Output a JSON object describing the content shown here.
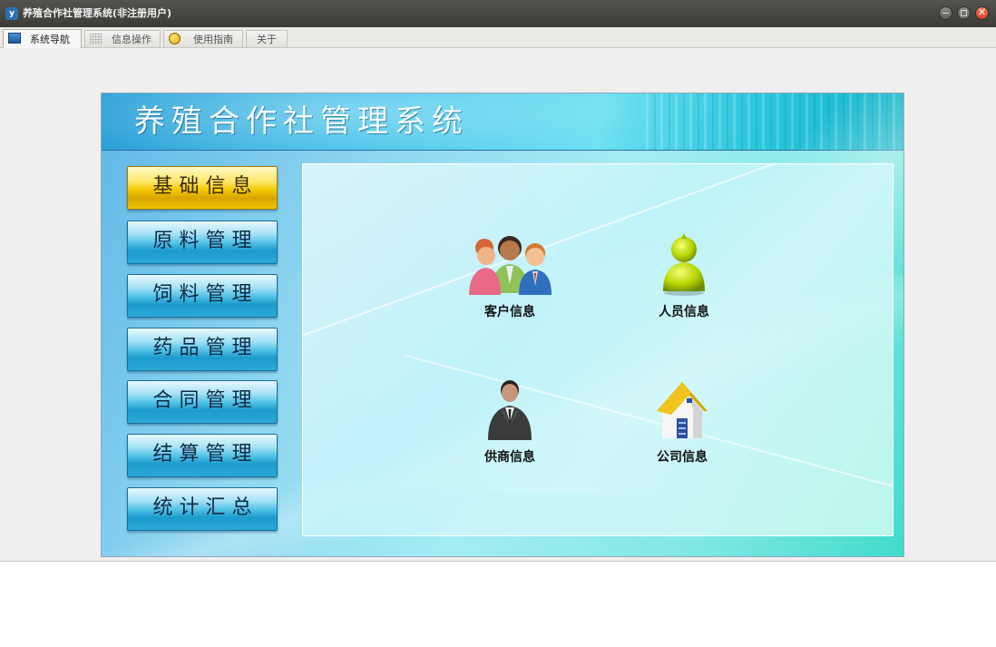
{
  "window": {
    "title": "养殖合作社管理系统(非注册用户)",
    "app_icon": "y"
  },
  "tabs": [
    {
      "label": "系统导航",
      "icon": "monitor-icon"
    },
    {
      "label": "信息操作",
      "icon": "grid-icon"
    },
    {
      "label": "使用指南",
      "icon": "guide-icon"
    },
    {
      "label": "关于",
      "icon": ""
    }
  ],
  "panel": {
    "title": "养殖合作社管理系统"
  },
  "sidebar": {
    "items": [
      {
        "label": "基础信息",
        "active": true
      },
      {
        "label": "原料管理",
        "active": false
      },
      {
        "label": "饲料管理",
        "active": false
      },
      {
        "label": "药品管理",
        "active": false
      },
      {
        "label": "合同管理",
        "active": false
      },
      {
        "label": "结算管理",
        "active": false
      },
      {
        "label": "统计汇总",
        "active": false
      }
    ]
  },
  "content": {
    "items": [
      {
        "label": "客户信息",
        "icon": "customers-icon"
      },
      {
        "label": "人员信息",
        "icon": "person-icon"
      },
      {
        "label": "供商信息",
        "icon": "supplier-icon"
      },
      {
        "label": "公司信息",
        "icon": "company-icon"
      }
    ]
  },
  "colors": {
    "active_button": "#f5c800",
    "button": "#1c9ccc",
    "titlebar": "#3c3b37",
    "close_button": "#d6431f"
  }
}
